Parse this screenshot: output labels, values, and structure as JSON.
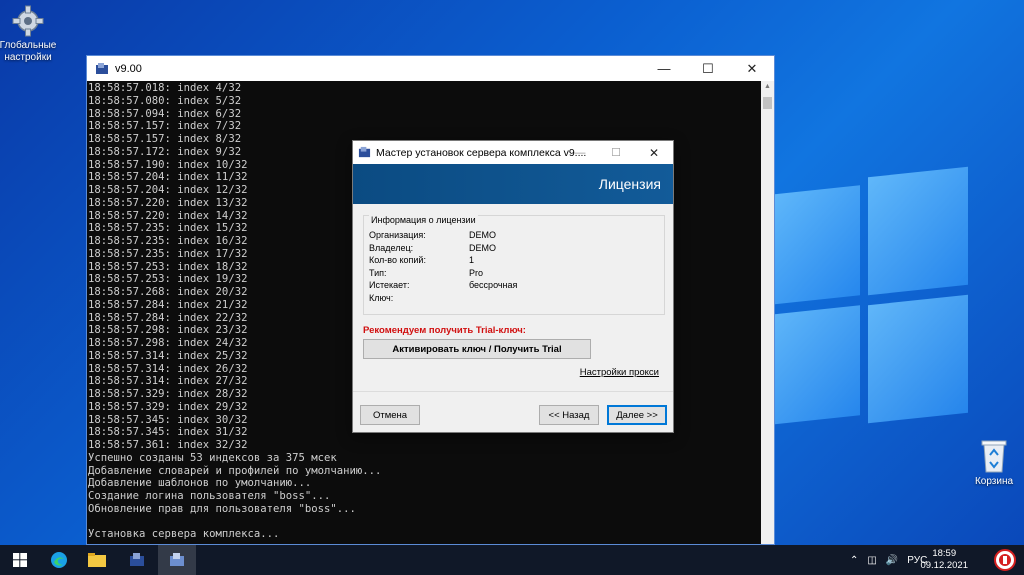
{
  "desktop": {
    "icons": [
      {
        "label_line1": "Глобальные",
        "label_line2": "настройки",
        "icon": "gear-icon"
      },
      {
        "label_line1": "Корзина",
        "label_line2": "",
        "icon": "recycle-bin-icon"
      }
    ]
  },
  "console": {
    "title": "v9.00",
    "lines": [
      "18:58:57.018: index 4/32",
      "18:58:57.080: index 5/32",
      "18:58:57.094: index 6/32",
      "18:58:57.157: index 7/32",
      "18:58:57.157: index 8/32",
      "18:58:57.172: index 9/32",
      "18:58:57.190: index 10/32",
      "18:58:57.204: index 11/32",
      "18:58:57.204: index 12/32",
      "18:58:57.220: index 13/32",
      "18:58:57.220: index 14/32",
      "18:58:57.235: index 15/32",
      "18:58:57.235: index 16/32",
      "18:58:57.235: index 17/32",
      "18:58:57.253: index 18/32",
      "18:58:57.253: index 19/32",
      "18:58:57.268: index 20/32",
      "18:58:57.284: index 21/32",
      "18:58:57.284: index 22/32",
      "18:58:57.298: index 23/32",
      "18:58:57.298: index 24/32",
      "18:58:57.314: index 25/32",
      "18:58:57.314: index 26/32",
      "18:58:57.314: index 27/32",
      "18:58:57.329: index 28/32",
      "18:58:57.329: index 29/32",
      "18:58:57.345: index 30/32",
      "18:58:57.345: index 31/32",
      "18:58:57.361: index 32/32",
      "Успешно созданы 53 индексов за 375 мсек",
      "Добавление словарей и профилей по умолчанию...",
      "Добавление шаблонов по умолчанию...",
      "Создание логина пользователя \"boss\"...",
      "Обновление прав для пользователя \"boss\"...",
      "",
      "Установка сервера комплекса..."
    ]
  },
  "wizard": {
    "title": "Мастер установок сервера комплекса v9....",
    "banner": "Лицензия",
    "group_legend": "Информация о лицензии",
    "fields": [
      {
        "label": "Организация:",
        "value": "DEMO"
      },
      {
        "label": "Владелец:",
        "value": "DEMO"
      },
      {
        "label": "Кол-во копий:",
        "value": "1"
      },
      {
        "label": "Тип:",
        "value": "Pro"
      },
      {
        "label": "Истекает:",
        "value": "бессрочная"
      },
      {
        "label": "Ключ:",
        "value": ""
      }
    ],
    "recommend": "Рекомендуем получить Trial-ключ:",
    "activate_button": "Активировать ключ / Получить Trial",
    "proxy_link": "Настройки прокси",
    "cancel_button": "Отмена",
    "back_button": "<< Назад",
    "next_button": "Далее >>"
  },
  "taskbar": {
    "language": "РУС",
    "time": "18:59",
    "date": "09.12.2021"
  }
}
